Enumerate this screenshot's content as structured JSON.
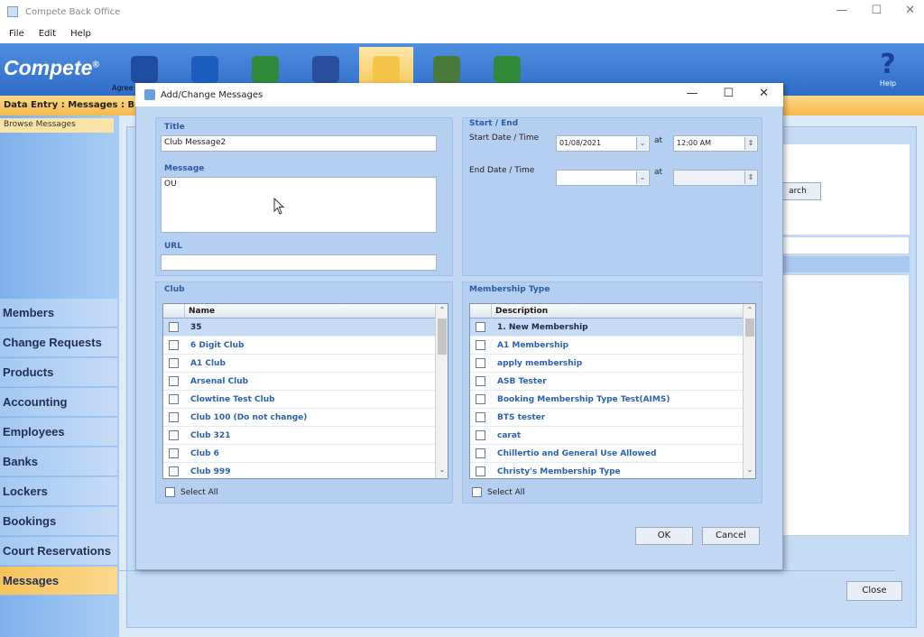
{
  "app": {
    "title": "Compete Back Office"
  },
  "menu": [
    "File",
    "Edit",
    "Help"
  ],
  "logo": {
    "text": "Compete",
    "mark": "®"
  },
  "toolbar": {
    "agree_label": "Agree",
    "help_label": "Help",
    "icons": [
      "pencil-icon",
      "clock-icon",
      "chart-icon",
      "wrench-icon",
      "calendar-icon",
      "people-icon",
      "report-icon"
    ],
    "active_index": 4,
    "colors": [
      "#1f4ea0",
      "#1a5fc0",
      "#2e8a3a",
      "#2b4f9c",
      "#f6c64a",
      "#4a7a3a",
      "#2f8a3a"
    ]
  },
  "breadcrumb": "Data Entry : Messages : Br",
  "sidebar": {
    "browse_tab": "Browse Messages",
    "items": [
      "Members",
      "Change Requests",
      "Products",
      "Accounting",
      "Employees",
      "Banks",
      "Lockers",
      "Bookings",
      "Court Reservations",
      "Messages"
    ],
    "active": "Messages"
  },
  "background": {
    "search_button": "arch",
    "close_button": "Close"
  },
  "dialog": {
    "title": "Add/Change Messages",
    "title_group_label": "Title",
    "title_value": "Club Message2",
    "message_label": "Message",
    "message_value": "OU",
    "url_label": "URL",
    "url_value": "",
    "start_end": {
      "group_label": "Start / End",
      "start_label": "Start Date / Time",
      "start_date": "01/08/2021",
      "start_time": "12:00 AM",
      "at1": "at",
      "end_label": "End Date / Time",
      "end_date": "",
      "end_time": "",
      "at2": "at"
    },
    "club": {
      "group_label": "Club",
      "column": "Name",
      "rows": [
        "35",
        "6 Digit Club",
        "A1 Club",
        "Arsenal Club",
        "Clowtine Test Club",
        "Club 100 (Do not change)",
        "Club 321",
        "Club 6",
        "Club 999"
      ],
      "selected_index": 0,
      "select_all": "Select All"
    },
    "membership": {
      "group_label": "Membership Type",
      "column": "Description",
      "rows": [
        "1. New Membership",
        "A1 Membership",
        "apply membership",
        "ASB Tester",
        "Booking Membership Type Test(AIMS)",
        "BTS tester",
        "carat",
        "Chillertio and General Use Allowed",
        "Christy's Membership Type"
      ],
      "selected_index": 0,
      "select_all": "Select All"
    },
    "ok_button": "OK",
    "cancel_button": "Cancel"
  }
}
